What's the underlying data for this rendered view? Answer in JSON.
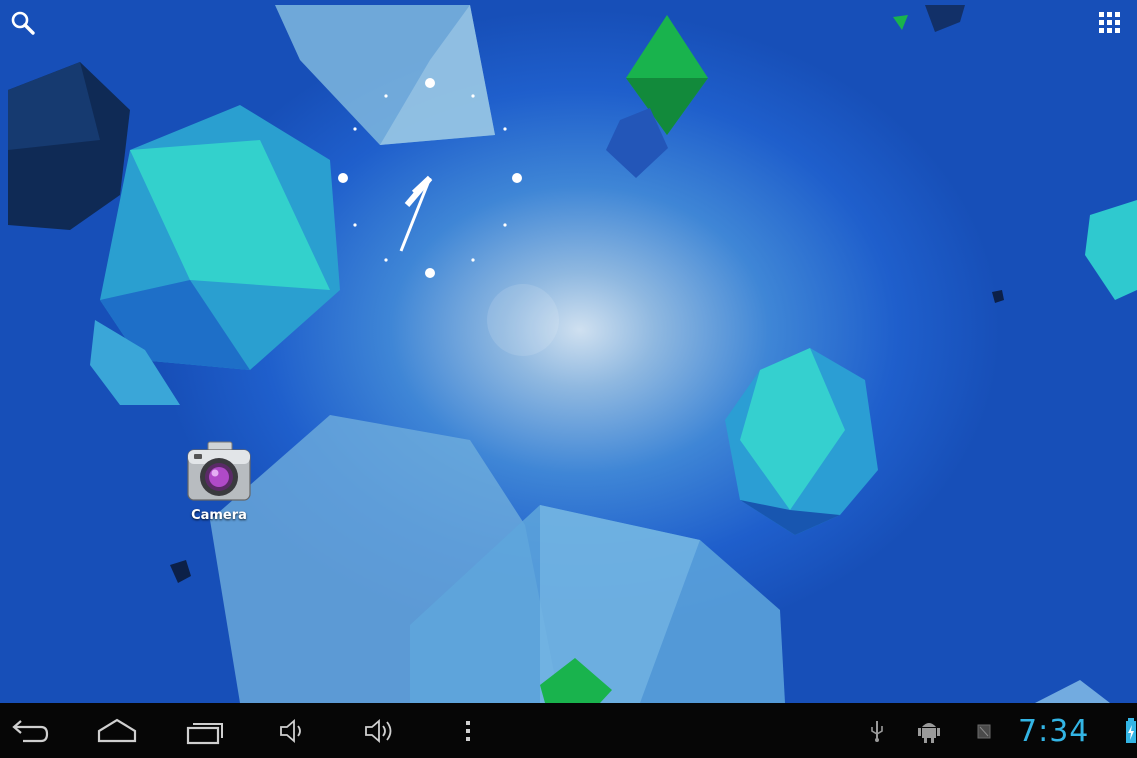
{
  "home": {
    "apps": [
      {
        "label": "Camera",
        "icon": "camera-icon"
      }
    ]
  },
  "widgets": {
    "analog_clock": {
      "hour": 7,
      "minute": 34
    }
  },
  "top_bar": {
    "search_icon": "search-icon",
    "apps_icon": "all-apps-grid-icon"
  },
  "system_bar": {
    "nav_buttons": [
      "back-icon",
      "home-icon",
      "recent-apps-icon",
      "volume-down-icon",
      "volume-up-icon",
      "menu-icon"
    ],
    "status_icons": [
      "usb-icon",
      "android-debug-icon",
      "sd-card-icon",
      "battery-charging-icon"
    ],
    "time": "7:34",
    "time_color": "#33b5e5"
  },
  "colors": {
    "wallpaper_blue": "#1f5fcc",
    "crystal_teal": "#2fc9c9",
    "crystal_green": "#18b04a",
    "navbar": "#060606"
  }
}
